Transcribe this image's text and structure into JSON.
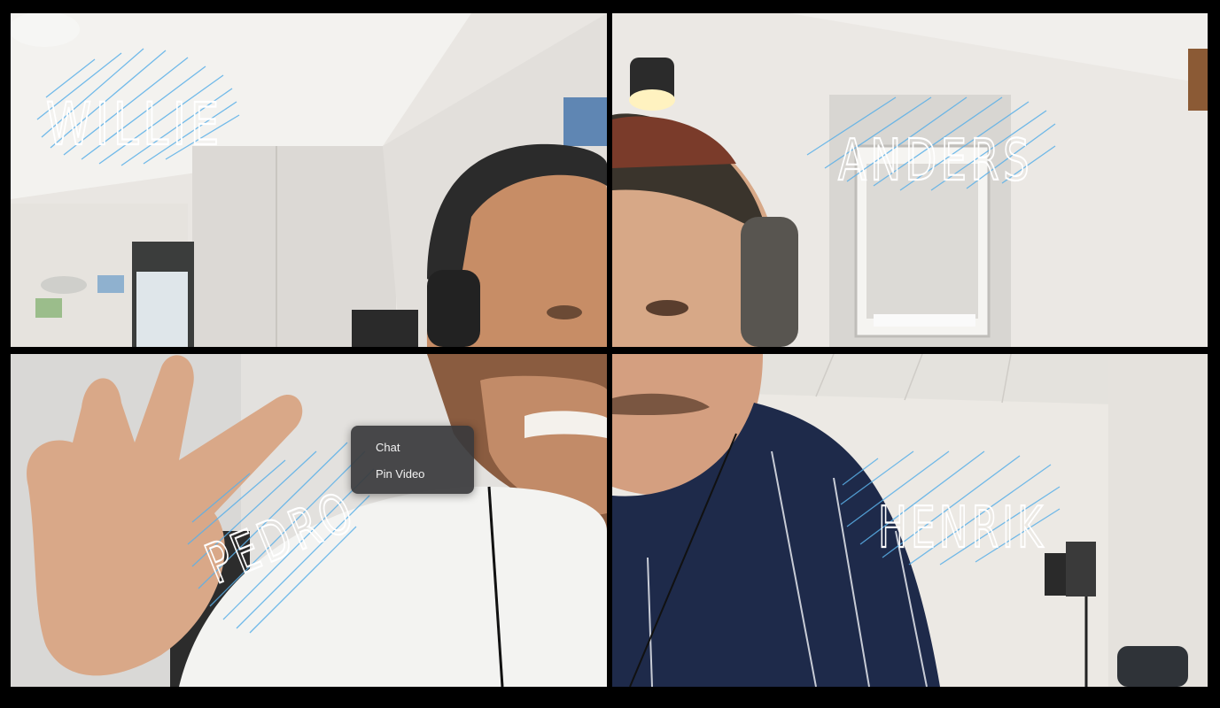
{
  "participants": [
    {
      "name": "WILLIE"
    },
    {
      "name": "ANDERS"
    },
    {
      "name": "PEDRO"
    },
    {
      "name": "HENRIK"
    }
  ],
  "context_menu": {
    "items": [
      {
        "label": "Chat"
      },
      {
        "label": "Pin Video"
      }
    ]
  },
  "colors": {
    "background": "#000000",
    "scribble": "#5ab0e8",
    "menu_bg": "#3a3a3c",
    "menu_text": "#f2f2f2"
  }
}
